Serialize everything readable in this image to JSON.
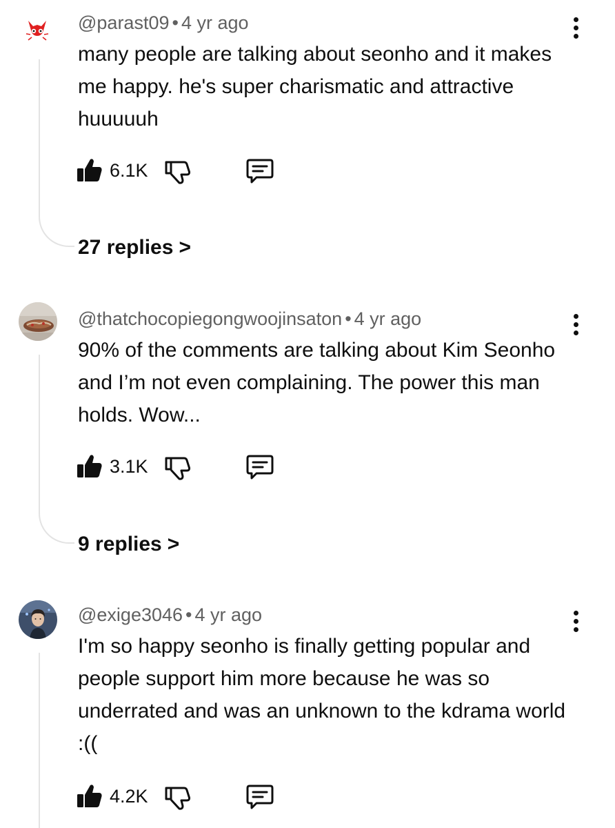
{
  "comments": [
    {
      "handle": "@parast09",
      "separator": "•",
      "time": "4 yr ago",
      "text": "many people are talking about seonho and it makes me happy. he's super charismatic and attractive huuuuuh",
      "likes": "6.1K",
      "replies_label": "27 replies",
      "avatar_icon": "red-cat-icon"
    },
    {
      "handle": "@thatchocopiegongwoojinsaton",
      "separator": "•",
      "time": "4 yr ago",
      "text": "90% of the comments are talking about Kim Seonho and I’m not even complaining. The power this man holds. Wow...",
      "likes": "3.1K",
      "replies_label": "9 replies",
      "avatar_icon": "snack-photo"
    },
    {
      "handle": "@exige3046",
      "separator": "•",
      "time": "4 yr ago",
      "text": "I'm so happy seonho is finally getting popular and people support him more because he was so underrated and was an unknown to the kdrama world :((",
      "likes": "4.2K",
      "avatar_icon": "person-photo"
    }
  ],
  "colors": {
    "text": "#0f0f0f",
    "meta": "#606060",
    "thread": "#e3e3e3",
    "accent": "#e02020"
  }
}
